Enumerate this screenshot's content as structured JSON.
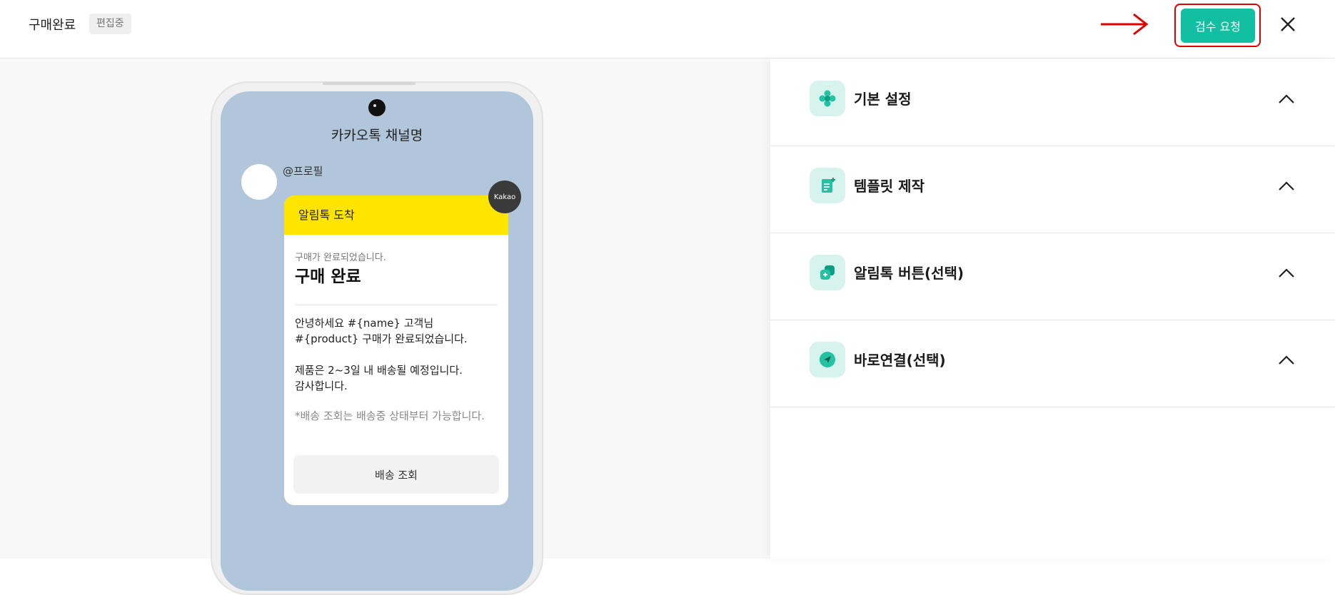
{
  "header": {
    "title": "구매완료",
    "status_badge": "편집중",
    "review_button": "검수 요청"
  },
  "preview": {
    "channel_name": "카카오톡 채널명",
    "profile_label": "@프로필",
    "kakao_badge": "Kakao",
    "card": {
      "header": "알림톡 도착",
      "subtitle": "구매가 완료되었습니다.",
      "title": "구매 완료",
      "body_lines": [
        "안녕하세요 #{name} 고객님",
        "#{product} 구매가 완료되었습니다.",
        "제품은 2~3일 내 배송될 예정입니다.",
        "감사합니다."
      ],
      "note": "*배송 조회는 배송중 상태부터 가능합니다.",
      "button": "배송 조회"
    }
  },
  "panel": {
    "sections": [
      {
        "label": "기본 설정",
        "icon": "flower-settings-icon"
      },
      {
        "label": "템플릿 제작",
        "icon": "template-doc-icon"
      },
      {
        "label": "알림톡 버튼(선택)",
        "icon": "button-add-icon"
      },
      {
        "label": "바로연결(선택)",
        "icon": "send-arrow-icon"
      }
    ]
  },
  "colors": {
    "accent": "#12c0a1",
    "accent_light": "#d6f3ee",
    "kakao_yellow": "#fee500",
    "highlight_red": "#e00000",
    "chat_bg": "#b1c6da"
  }
}
